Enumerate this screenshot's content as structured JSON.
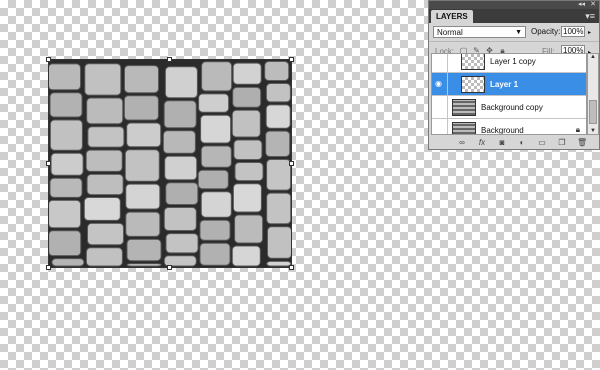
{
  "canvas": {
    "image_description_name": "cobblestone-layer"
  },
  "layers_panel": {
    "tab_label": "LAYERS",
    "blend_mode": "Normal",
    "opacity_label": "Opacity:",
    "opacity_value": "100%",
    "lock_label": "Lock:",
    "fill_label": "Fill:",
    "fill_value": "100%",
    "layers": [
      {
        "name": "Layer 1 copy",
        "visible": false,
        "selected": false,
        "thumb": "transparent"
      },
      {
        "name": "Layer 1",
        "visible": true,
        "selected": true,
        "thumb": "transparent"
      },
      {
        "name": "Background copy",
        "visible": false,
        "selected": false,
        "thumb": "stone"
      },
      {
        "name": "Background",
        "visible": false,
        "selected": false,
        "thumb": "stone",
        "locked": true
      }
    ],
    "selection_color": "#3a8ee6",
    "bottom_icons": [
      "link-icon",
      "fx-icon",
      "mask-icon",
      "adjustment-icon",
      "group-icon",
      "new-layer-icon",
      "trash-icon"
    ]
  }
}
